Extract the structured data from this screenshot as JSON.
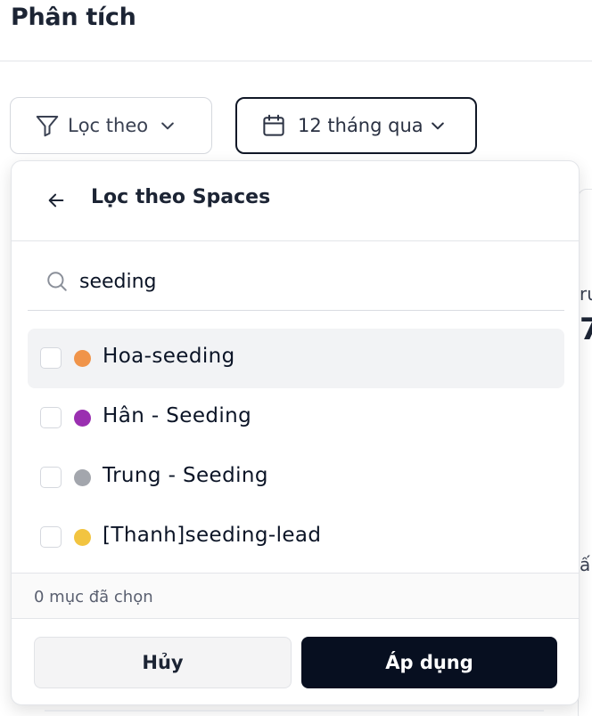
{
  "page": {
    "title": "Phân tích"
  },
  "toolbar": {
    "filter_label": "Lọc theo",
    "date_label": "12 tháng qua"
  },
  "background": {
    "frag_1": "ru",
    "frag_2": "7",
    "frag_3": "ấ"
  },
  "panel": {
    "title": "Lọc theo Spaces",
    "search": {
      "value": "seeding",
      "placeholder": ""
    },
    "items": [
      {
        "label": "Hoa-seeding",
        "color": "#f0944a",
        "checked": false
      },
      {
        "label": "Hân - Seeding",
        "color": "#9a2fb0",
        "checked": false
      },
      {
        "label": "Trung - Seeding",
        "color": "#a3a6ad",
        "checked": false
      },
      {
        "label": "[Thanh]seeding-lead",
        "color": "#f2c440",
        "checked": false
      }
    ],
    "selected_count_text": "0 mục đã chọn",
    "cancel_label": "Hủy",
    "apply_label": "Áp dụng"
  },
  "icons": {
    "filter": "filter-icon",
    "calendar": "calendar-icon",
    "chevron": "chevron-down-icon",
    "back": "arrow-left-icon",
    "search": "search-icon"
  }
}
